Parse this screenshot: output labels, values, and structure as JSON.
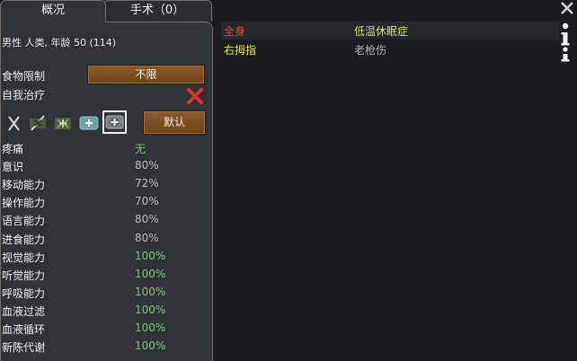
{
  "tabs": {
    "overview": "概况",
    "surgery": "手术（0）"
  },
  "pawn_info": "男性 人类, 年龄 50 (114)",
  "food_restriction": {
    "label": "食物限制",
    "value": "不限"
  },
  "self_tend": {
    "label": "自我治疗"
  },
  "medicine_default_button": "默认",
  "capacities": [
    {
      "name": "疼痛",
      "value": "无",
      "color": "#7fc27f"
    },
    {
      "name": "意识",
      "value": "80%",
      "color": "#b9b9b9"
    },
    {
      "name": "移动能力",
      "value": "72%",
      "color": "#b9b9b9"
    },
    {
      "name": "操作能力",
      "value": "70%",
      "color": "#b9b9b9"
    },
    {
      "name": "语言能力",
      "value": "80%",
      "color": "#b9b9b9"
    },
    {
      "name": "进食能力",
      "value": "80%",
      "color": "#b9b9b9"
    },
    {
      "name": "视觉能力",
      "value": "100%",
      "color": "#7fc27f"
    },
    {
      "name": "听觉能力",
      "value": "100%",
      "color": "#7fc27f"
    },
    {
      "name": "呼吸能力",
      "value": "100%",
      "color": "#7fc27f"
    },
    {
      "name": "血液过滤",
      "value": "100%",
      "color": "#7fc27f"
    },
    {
      "name": "血液循环",
      "value": "100%",
      "color": "#7fc27f"
    },
    {
      "name": "新陈代谢",
      "value": "100%",
      "color": "#7fc27f"
    }
  ],
  "hediffs": [
    {
      "part": "全身",
      "part_color": "#e0443a",
      "condition": "低温休眠症",
      "condition_color": "#d8d87a"
    },
    {
      "part": "右拇指",
      "part_color": "#e6e64a",
      "condition": "老枪伤",
      "condition_color": "#b0b0b0"
    }
  ],
  "colors": {
    "panel": "#303337",
    "background": "#1a1c1f",
    "close_red": "#d32f2f"
  },
  "icons": [
    "close-icon",
    "info-icon",
    "red-x-icon",
    "medicine-none-icon",
    "herbal-medicine-icon",
    "industrial-medicine-icon",
    "glitterworld-medicine-icon"
  ]
}
